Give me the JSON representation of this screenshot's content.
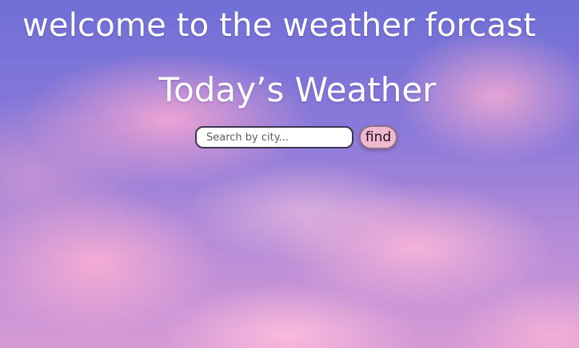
{
  "page": {
    "welcome_text": "welcome to the weather forcast",
    "title": "Today’s Weather"
  },
  "search": {
    "placeholder": "Search by city...",
    "value": "",
    "button_label": "find"
  },
  "colors": {
    "text": "#ffffff",
    "button_background": "#f1b9cd",
    "input_border": "#3b3650"
  },
  "background": {
    "description_icon": "pink-cloud-sky-background"
  }
}
